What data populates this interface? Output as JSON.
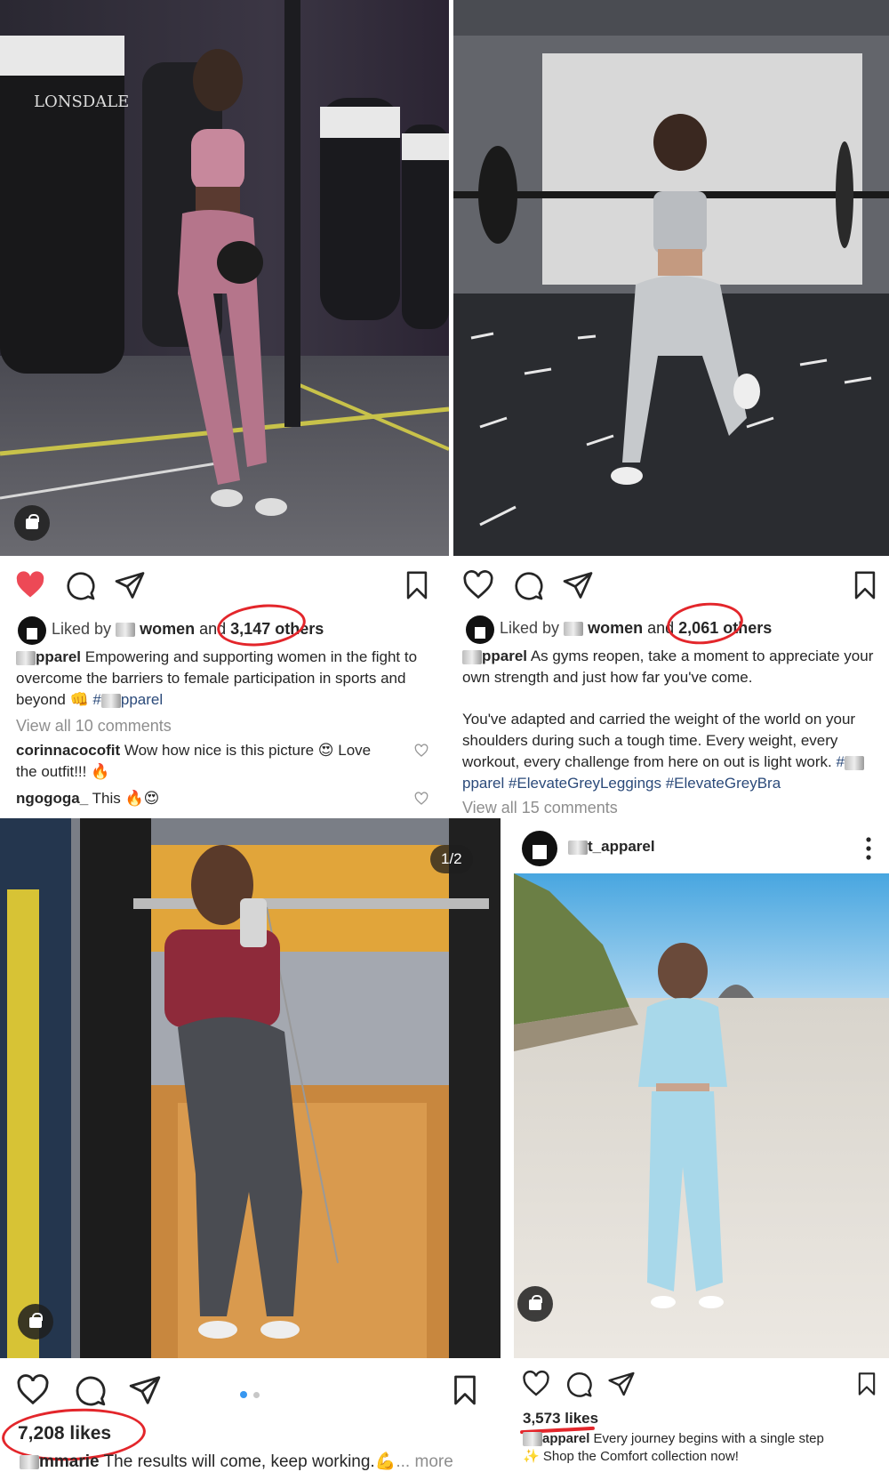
{
  "post1": {
    "liked_prefix": "Liked by",
    "liked_user": "women",
    "liked_and": "and",
    "liked_count": "3,147",
    "liked_others": "others",
    "caption_user": "pparel",
    "caption_text": "Empowering and supporting women in the fight to overcome the barriers to female participation in sports and beyond",
    "caption_tag": "pparel",
    "view_comments": "View all 10 comments",
    "comments": [
      {
        "user": "corinnacocofit",
        "text": "Wow how nice is this picture 😍 Love the outfit!!! 🔥"
      },
      {
        "user": "ngogoga_",
        "text": "This 🔥😍"
      }
    ]
  },
  "post2": {
    "liked_prefix": "Liked by",
    "liked_user": "women",
    "liked_and": "and",
    "liked_count": "2,061",
    "liked_others": "others",
    "caption_user": "pparel",
    "caption_text": "As gyms reopen, take a moment to appreciate your own strength and just how far you've come.",
    "caption_text2": "You've adapted and carried the weight of the world on your shoulders during such a tough time. Every weight, every workout, every challenge from here on out is light work.",
    "caption_tags": "pparel #ElevateGreyLeggings #ElevateGreyBra",
    "view_comments": "View all 15 comments"
  },
  "post3": {
    "page_indicator": "1/2",
    "likes": "7,208 likes",
    "caption_user": "mmarie",
    "caption_text": "The results will come, keep working.💪",
    "more": "... more"
  },
  "post4": {
    "username": "t_apparel",
    "likes": "3,573 likes",
    "caption_user": "apparel",
    "caption_text": "Every journey begins with a single step ✨ Shop the Comfort collection now!"
  },
  "icons": [
    "heart-icon",
    "comment-icon",
    "share-icon",
    "bookmark-icon",
    "more-icon",
    "shopping-bag-icon",
    "user-tag-icon"
  ],
  "colors": {
    "like_red": "#ed4956",
    "annotation_red": "#e3262b",
    "hashtag_blue": "#2b4a7a",
    "muted_grey": "#8e8e8e"
  }
}
